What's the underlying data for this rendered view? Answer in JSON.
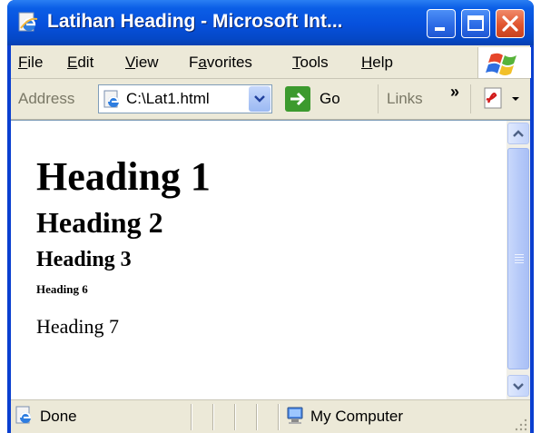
{
  "window": {
    "title": "Latihan Heading - Microsoft Int...",
    "controls": [
      "minimize",
      "maximize",
      "close"
    ]
  },
  "menu": {
    "items": [
      {
        "label": "File",
        "accel": "F",
        "rest": "ile"
      },
      {
        "label": "Edit",
        "accel": "E",
        "rest": "dit"
      },
      {
        "label": "View",
        "accel": "V",
        "rest": "iew"
      },
      {
        "label": "Favorites",
        "pre": "F",
        "accel": "a",
        "rest": "vorites"
      },
      {
        "label": "Tools",
        "accel": "T",
        "rest": "ools"
      },
      {
        "label": "Help",
        "accel": "H",
        "rest": "elp"
      }
    ]
  },
  "address_bar": {
    "label": "Address",
    "value": "C:\\Lat1.html",
    "go_label": "Go",
    "links_label": "Links",
    "chevron": "»"
  },
  "page": {
    "h1": "Heading 1",
    "h2": "Heading 2",
    "h3": "Heading 3",
    "h6": "Heading 6",
    "p": "Heading 7"
  },
  "status": {
    "text": "Done",
    "zone": "My Computer"
  },
  "colors": {
    "titlebar": "#0650dc",
    "chrome": "#ece9d8",
    "close_button": "#e0552e",
    "go_arrow": "#3c9a2e"
  },
  "icons": {
    "title": "ie-page-icon",
    "address": "ie-page-icon",
    "go": "green-arrow-icon",
    "toolbar_extra": "pdf-icon",
    "status": "ie-page-icon",
    "zone": "my-computer-icon"
  }
}
